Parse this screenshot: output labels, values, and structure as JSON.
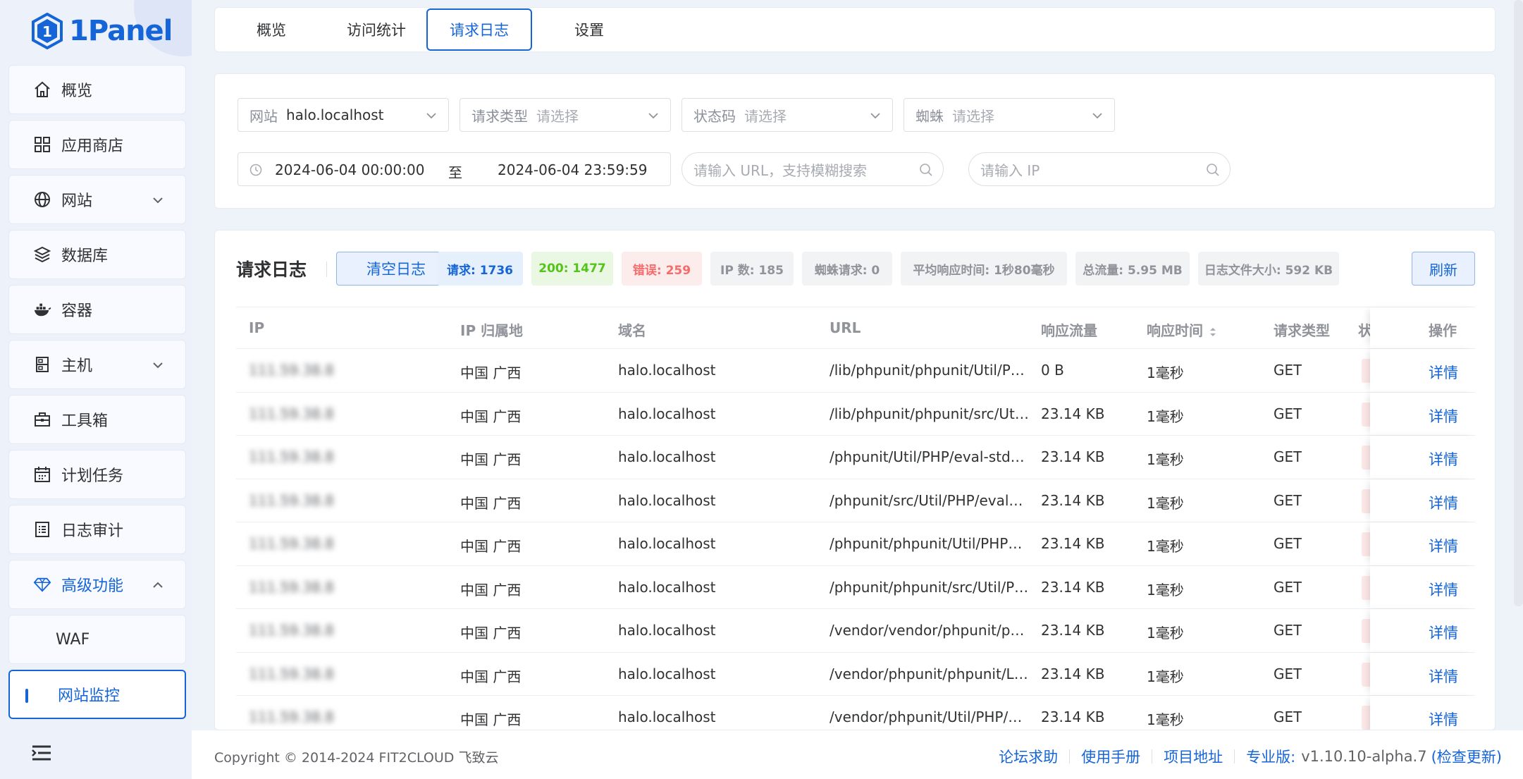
{
  "brand": {
    "name": "1Panel",
    "color": "#1565d8"
  },
  "sidebar": {
    "items": [
      {
        "label": "概览",
        "icon": "home-icon"
      },
      {
        "label": "应用商店",
        "icon": "grid-icon"
      },
      {
        "label": "网站",
        "icon": "globe-icon",
        "expandable": true
      },
      {
        "label": "数据库",
        "icon": "layers-icon"
      },
      {
        "label": "容器",
        "icon": "docker-icon"
      },
      {
        "label": "主机",
        "icon": "server-icon",
        "expandable": true
      },
      {
        "label": "工具箱",
        "icon": "toolbox-icon"
      },
      {
        "label": "计划任务",
        "icon": "calendar-icon"
      },
      {
        "label": "日志审计",
        "icon": "log-icon"
      },
      {
        "label": "高级功能",
        "icon": "diamond-icon",
        "expanded": true
      }
    ],
    "subitems": [
      {
        "label": "WAF"
      },
      {
        "label": "网站监控",
        "selected": true
      }
    ]
  },
  "tabs": [
    {
      "label": "概览"
    },
    {
      "label": "访问统计"
    },
    {
      "label": "请求日志",
      "active": true
    },
    {
      "label": "设置"
    }
  ],
  "filters": {
    "site": {
      "prefix": "网站",
      "value": "halo.localhost"
    },
    "request_type": {
      "prefix": "请求类型",
      "placeholder": "请选择"
    },
    "status_code": {
      "prefix": "状态码",
      "placeholder": "请选择"
    },
    "spider": {
      "prefix": "蜘蛛",
      "placeholder": "请选择"
    },
    "date_start": "2024-06-04 00:00:00",
    "date_sep": "至",
    "date_end": "2024-06-04 23:59:59",
    "url_placeholder": "请输入 URL，支持模糊搜索",
    "ip_placeholder": "请输入 IP"
  },
  "log": {
    "title": "请求日志",
    "clear_label": "清空日志",
    "refresh_label": "刷新",
    "stats": [
      {
        "label": "请求: 1736",
        "bg": "#e6f0fc",
        "color": "#1565d8"
      },
      {
        "label": "200: 1477",
        "bg": "#eaf7e3",
        "color": "#52c41a"
      },
      {
        "label": "错误: 259",
        "bg": "#fdecec",
        "color": "#f56c6c"
      },
      {
        "label": "IP 数: 185",
        "bg": "#f2f3f5",
        "color": "#909399"
      },
      {
        "label": "蜘蛛请求: 0",
        "bg": "#f2f3f5",
        "color": "#909399"
      },
      {
        "label": "平均响应时间: 1秒80毫秒",
        "bg": "#f2f3f5",
        "color": "#909399"
      },
      {
        "label": "总流量: 5.95 MB",
        "bg": "#f2f3f5",
        "color": "#909399"
      },
      {
        "label": "日志文件大小: 592 KB",
        "bg": "#f2f3f5",
        "color": "#909399"
      }
    ],
    "columns": {
      "ip": "IP",
      "location": "IP 归属地",
      "domain": "域名",
      "url": "URL",
      "traffic": "响应流量",
      "resp_time": "响应时间",
      "method": "请求类型",
      "status": "状",
      "action": "操作"
    },
    "rows": [
      {
        "ip": "111.59.38.8",
        "location": "中国 广西",
        "domain": "halo.localhost",
        "url": "/lib/phpunit/phpunit/Util/P…",
        "traffic": "0 B",
        "resp_time": "1毫秒",
        "method": "GET",
        "action": "详情"
      },
      {
        "ip": "111.59.38.8",
        "location": "中国 广西",
        "domain": "halo.localhost",
        "url": "/lib/phpunit/phpunit/src/Ut…",
        "traffic": "23.14 KB",
        "resp_time": "1毫秒",
        "method": "GET",
        "action": "详情"
      },
      {
        "ip": "111.59.38.8",
        "location": "中国 广西",
        "domain": "halo.localhost",
        "url": "/phpunit/Util/PHP/eval-std…",
        "traffic": "23.14 KB",
        "resp_time": "1毫秒",
        "method": "GET",
        "action": "详情"
      },
      {
        "ip": "111.59.38.8",
        "location": "中国 广西",
        "domain": "halo.localhost",
        "url": "/phpunit/src/Util/PHP/eval…",
        "traffic": "23.14 KB",
        "resp_time": "1毫秒",
        "method": "GET",
        "action": "详情"
      },
      {
        "ip": "111.59.38.8",
        "location": "中国 广西",
        "domain": "halo.localhost",
        "url": "/phpunit/phpunit/Util/PHP…",
        "traffic": "23.14 KB",
        "resp_time": "1毫秒",
        "method": "GET",
        "action": "详情"
      },
      {
        "ip": "111.59.38.8",
        "location": "中国 广西",
        "domain": "halo.localhost",
        "url": "/phpunit/phpunit/src/Util/P…",
        "traffic": "23.14 KB",
        "resp_time": "1毫秒",
        "method": "GET",
        "action": "详情"
      },
      {
        "ip": "111.59.38.8",
        "location": "中国 广西",
        "domain": "halo.localhost",
        "url": "/vendor/vendor/phpunit/p…",
        "traffic": "23.14 KB",
        "resp_time": "1毫秒",
        "method": "GET",
        "action": "详情"
      },
      {
        "ip": "111.59.38.8",
        "location": "中国 广西",
        "domain": "halo.localhost",
        "url": "/vendor/phpunit/phpunit/L…",
        "traffic": "23.14 KB",
        "resp_time": "1毫秒",
        "method": "GET",
        "action": "详情"
      },
      {
        "ip": "111.59.38.8",
        "location": "中国 广西",
        "domain": "halo.localhost",
        "url": "/vendor/phpunit/Util/PHP/…",
        "traffic": "23.14 KB",
        "resp_time": "1毫秒",
        "method": "GET",
        "action": "详情"
      }
    ]
  },
  "footer": {
    "copyright": "Copyright © 2014-2024 FIT2CLOUD 飞致云",
    "links": [
      "论坛求助",
      "使用手册",
      "项目地址"
    ],
    "version_label": "专业版:",
    "version": "v1.10.10-alpha.7",
    "check_update": "(检查更新)"
  }
}
